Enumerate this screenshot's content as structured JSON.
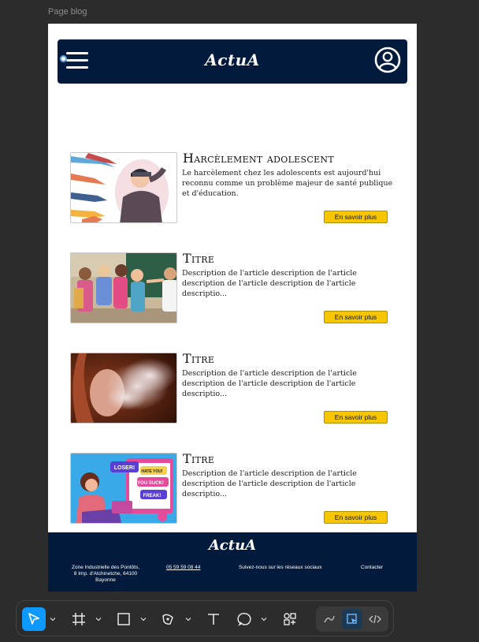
{
  "frame_label": "Page blog",
  "header": {
    "logo": "ActuA"
  },
  "articles": [
    {
      "title": "Harcèlement adolescent",
      "description": "Le harcèlement chez les adolescents est aujourd'hui reconnu comme un problème majeur de santé publique et d'éducation.",
      "button": "En savoir plus",
      "image": "bullying-illustration"
    },
    {
      "title": "Titre",
      "description": "Description de l'article description de l'article description de l'article description de l'article descriptio...",
      "button": "En savoir plus",
      "image": "children-classroom-photo"
    },
    {
      "title": "Titre",
      "description": "Description de l'article description de l'article description de l'article description de l'article descriptio...",
      "button": "En savoir plus",
      "image": "vaping-photo"
    },
    {
      "title": "Titre",
      "description": "Description de l'article description de l'article description de l'article description de l'article descriptio...",
      "button": "En savoir plus",
      "image": "cyberbullying-illustration"
    }
  ],
  "footer": {
    "logo": "ActuA",
    "address": "Zone Industrielle des Pontôts, 8 Imp. d'Atchinetche, 64100 Bayonne",
    "phone": "05 59 59 08 44",
    "social": "Suivez-nous sur les réseaux sociaux",
    "contact": "Contacter"
  },
  "bubble_labels": {
    "b1": "LOSER!",
    "b2": "HATE YOU!",
    "b3": "YOU SUCK!",
    "b4": "FREAK!"
  },
  "colors": {
    "header_bg": "#021a3c",
    "button_bg": "#f6c600",
    "canvas_bg": "#2c2c2c",
    "active_tool": "#0d99ff"
  },
  "toolbar": {
    "tools": [
      "move-tool",
      "frame-tool",
      "shape-tool",
      "pen-tool",
      "text-tool",
      "comment-tool",
      "actions-tool"
    ],
    "modes": [
      "draw-mode",
      "design-mode",
      "dev-mode"
    ]
  }
}
